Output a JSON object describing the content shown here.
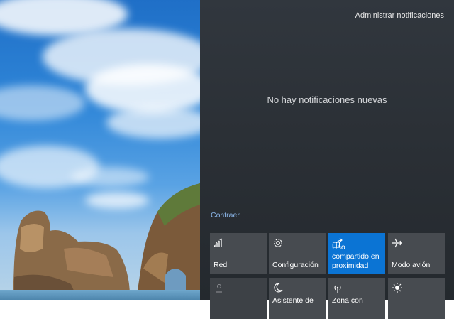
{
  "panel": {
    "manage_label": "Administrar notificaciones",
    "empty_message": "No hay notificaciones nuevas",
    "collapse_label": "Contraer"
  },
  "tiles": [
    {
      "label": "Red",
      "icon": "network-icon",
      "active": false
    },
    {
      "label": "Configuración",
      "icon": "gear-icon",
      "active": false
    },
    {
      "label": "Uso compartido en proximidad",
      "icon": "nearby-sharing-icon",
      "active": true
    },
    {
      "label": "Modo avión",
      "icon": "airplane-icon",
      "active": false
    },
    {
      "label": "",
      "icon": "location-icon",
      "active": false
    },
    {
      "label": "Asistente de",
      "icon": "moon-icon",
      "active": false
    },
    {
      "label": "Zona con",
      "icon": "hotspot-icon",
      "active": false
    },
    {
      "label": "",
      "icon": "brightness-icon",
      "active": false
    }
  ],
  "colors": {
    "accent": "#0b74d4",
    "tile": "#474b50",
    "panel": "#2b3036",
    "link": "#8ab4e6"
  }
}
